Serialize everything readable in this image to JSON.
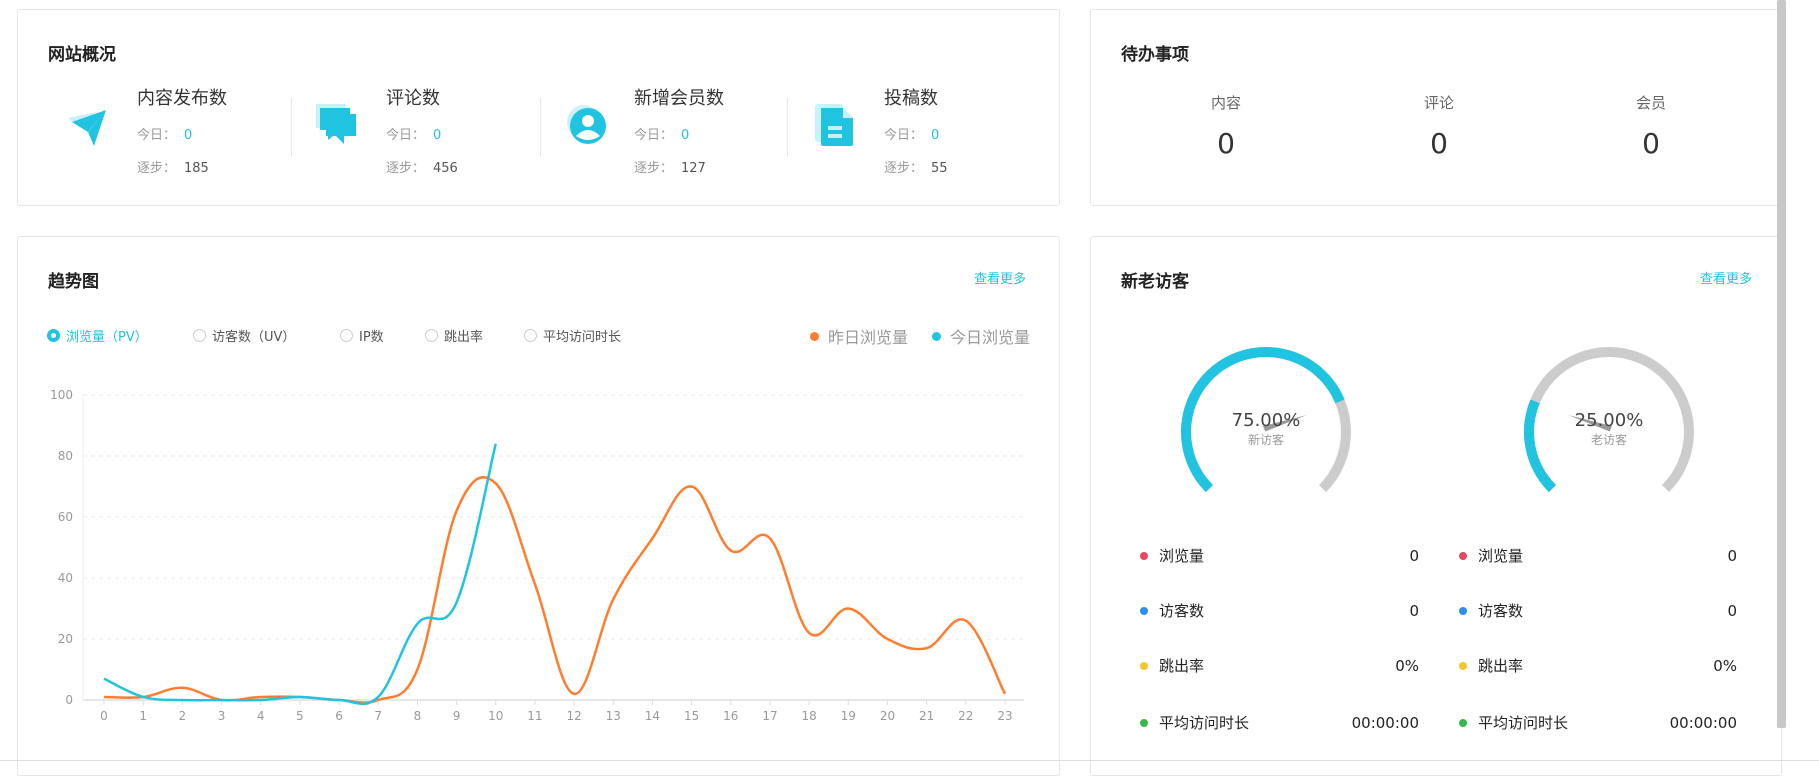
{
  "overview": {
    "title": "网站概况",
    "items": [
      {
        "icon": "paper-plane-icon",
        "name": "内容发布数",
        "today_label": "今日：",
        "today": "0",
        "total_label": "逐步：",
        "total": "185"
      },
      {
        "icon": "comments-icon",
        "name": "评论数",
        "today_label": "今日：",
        "today": "0",
        "total_label": "逐步：",
        "total": "456"
      },
      {
        "icon": "user-circle-icon",
        "name": "新增会员数",
        "today_label": "今日：",
        "today": "0",
        "total_label": "逐步：",
        "total": "127"
      },
      {
        "icon": "document-icon",
        "name": "投稿数",
        "today_label": "今日：",
        "today": "0",
        "total_label": "逐步：",
        "total": "55"
      }
    ]
  },
  "todo": {
    "title": "待办事项",
    "items": [
      {
        "label": "内容",
        "value": "0"
      },
      {
        "label": "评论",
        "value": "0"
      },
      {
        "label": "会员",
        "value": "0"
      }
    ]
  },
  "trend": {
    "title": "趋势图",
    "more": "查看更多",
    "metrics": [
      "浏览量（PV）",
      "访客数（UV）",
      "IP数",
      "跳出率",
      "平均访问时长"
    ],
    "selected": 0
  },
  "visitors": {
    "title": "新老访客",
    "more": "查看更多",
    "gauges": [
      {
        "percent": "75.00%",
        "value": 75,
        "label": "新访客"
      },
      {
        "percent": "25.00%",
        "value": 25,
        "label": "老访客"
      }
    ],
    "stats": [
      [
        {
          "label": "浏览量",
          "value": "0",
          "color": "#e8475f"
        },
        {
          "label": "访客数",
          "value": "0",
          "color": "#2b8ff0"
        },
        {
          "label": "跳出率",
          "value": "0%",
          "color": "#f5c52b"
        },
        {
          "label": "平均访问时长",
          "value": "00:00:00",
          "color": "#36b84f"
        }
      ],
      [
        {
          "label": "浏览量",
          "value": "0",
          "color": "#e8475f"
        },
        {
          "label": "访客数",
          "value": "0",
          "color": "#2b8ff0"
        },
        {
          "label": "跳出率",
          "value": "0%",
          "color": "#f5c52b"
        },
        {
          "label": "平均访问时长",
          "value": "00:00:00",
          "color": "#36b84f"
        }
      ]
    ]
  },
  "colors": {
    "accent": "#20c3e0",
    "orange": "#ff7d2e",
    "gray": "#cccccc"
  },
  "chart_data": {
    "type": "line",
    "x": [
      "0",
      "1",
      "2",
      "3",
      "4",
      "5",
      "6",
      "7",
      "8",
      "9",
      "10",
      "11",
      "12",
      "13",
      "14",
      "15",
      "16",
      "17",
      "18",
      "19",
      "20",
      "21",
      "22",
      "23"
    ],
    "ylim": [
      0,
      100
    ],
    "yticks": [
      "0",
      "20",
      "40",
      "60",
      "80",
      "100"
    ],
    "grid": true,
    "legend": "top-right",
    "series": [
      {
        "name": "昨日浏览量",
        "color": "#ff7d2e",
        "values": [
          1,
          1,
          4,
          0,
          1,
          1,
          0,
          0,
          10,
          62,
          71,
          38,
          2,
          33,
          53,
          70,
          49,
          53,
          22,
          30,
          20,
          17,
          26,
          2
        ]
      },
      {
        "name": "今日浏览量",
        "color": "#20c3e0",
        "values": [
          7,
          1,
          0,
          0,
          0,
          1,
          0,
          1,
          25,
          32,
          84
        ]
      }
    ]
  }
}
